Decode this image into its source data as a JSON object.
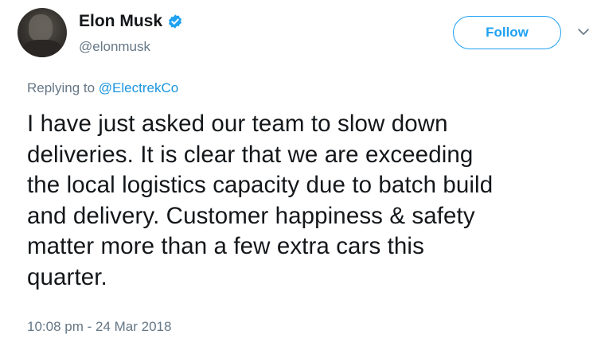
{
  "author": {
    "display_name": "Elon Musk",
    "handle": "@elonmusk",
    "verified": true,
    "avatar_icon": "profile-photo"
  },
  "actions": {
    "follow_label": "Follow",
    "more_icon": "chevron-down-icon"
  },
  "reply": {
    "prefix": "Replying to ",
    "to": "@ElectrekCo"
  },
  "tweet": {
    "lines": [
      "I have just asked our team to slow down",
      "deliveries. It is clear that we are exceeding",
      "the local logistics capacity due to batch build",
      "and delivery. Customer happiness & safety",
      "matter more than a few extra cars this",
      "quarter."
    ]
  },
  "timestamp": "10:08 pm - 24 Mar 2018",
  "colors": {
    "accent": "#1da1f2",
    "link": "#1b95e0",
    "muted": "#657786",
    "text": "#14171a"
  }
}
